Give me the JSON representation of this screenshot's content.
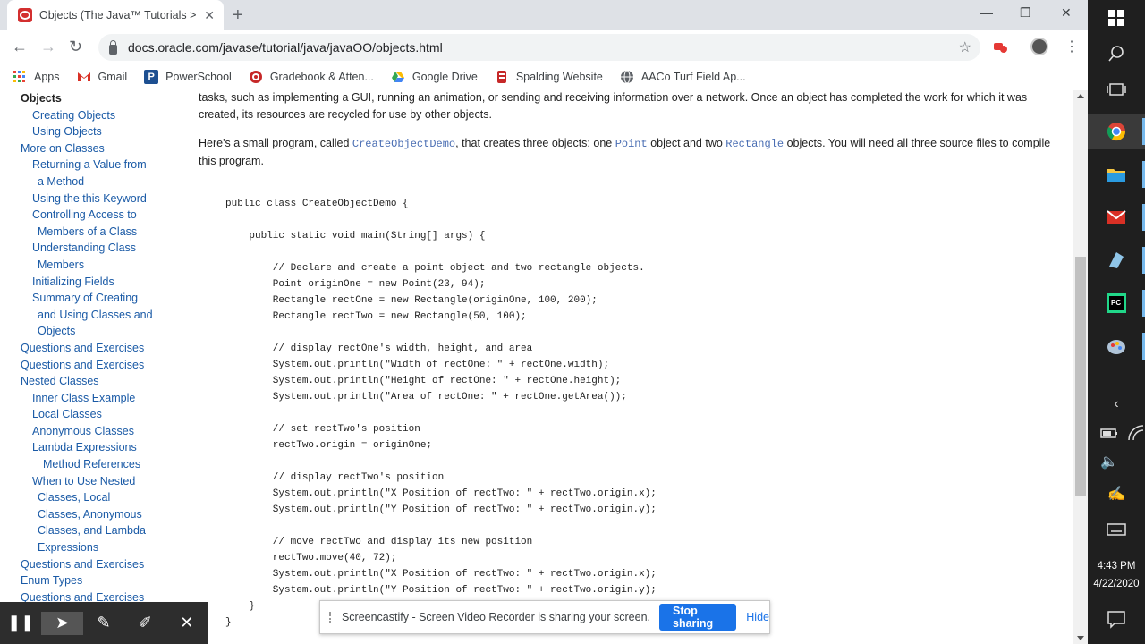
{
  "browser": {
    "tab_title": "Objects (The Java™ Tutorials > Le",
    "url": "docs.oracle.com/javase/tutorial/java/javaOO/objects.html"
  },
  "bookmarks": [
    {
      "label": "Apps",
      "icon": "apps-grid-icon",
      "color": "#4285f4"
    },
    {
      "label": "Gmail",
      "icon": "gmail-icon",
      "color": "#d93025"
    },
    {
      "label": "PowerSchool",
      "icon": "powerschool-icon",
      "color": "#1d4f91"
    },
    {
      "label": "Gradebook & Atten...",
      "icon": "gradebook-icon",
      "color": "#c62828"
    },
    {
      "label": "Google Drive",
      "icon": "google-drive-icon",
      "color": "#fbbc04"
    },
    {
      "label": "Spalding Website",
      "icon": "spalding-icon",
      "color": "#c62828"
    },
    {
      "label": "AACo Turf Field Ap...",
      "icon": "globe-icon",
      "color": "#5f6368"
    }
  ],
  "sidebar": [
    {
      "label": "Objects",
      "level": 1,
      "current": true
    },
    {
      "label": "Creating Objects",
      "level": 2
    },
    {
      "label": "Using Objects",
      "level": 2
    },
    {
      "label": "More on Classes",
      "level": 1
    },
    {
      "label": "Returning a Value from",
      "level": 2
    },
    {
      "label": "a Method",
      "level": 2,
      "cont": true
    },
    {
      "label": "Using the this Keyword",
      "level": 2
    },
    {
      "label": "Controlling Access to",
      "level": 2
    },
    {
      "label": "Members of a Class",
      "level": 2,
      "cont": true
    },
    {
      "label": "Understanding Class",
      "level": 2
    },
    {
      "label": "Members",
      "level": 2,
      "cont": true
    },
    {
      "label": "Initializing Fields",
      "level": 2
    },
    {
      "label": "Summary of Creating",
      "level": 2
    },
    {
      "label": "and Using Classes and",
      "level": 2,
      "cont": true
    },
    {
      "label": "Objects",
      "level": 2,
      "cont": true
    },
    {
      "label": "Questions and Exercises",
      "level": 1
    },
    {
      "label": "Questions and Exercises",
      "level": 1
    },
    {
      "label": "Nested Classes",
      "level": 1
    },
    {
      "label": "Inner Class Example",
      "level": 2
    },
    {
      "label": "Local Classes",
      "level": 2
    },
    {
      "label": "Anonymous Classes",
      "level": 2
    },
    {
      "label": "Lambda Expressions",
      "level": 2
    },
    {
      "label": "Method References",
      "level": 3
    },
    {
      "label": "When to Use Nested",
      "level": 2
    },
    {
      "label": "Classes, Local",
      "level": 2,
      "cont": true
    },
    {
      "label": "Classes, Anonymous",
      "level": 2,
      "cont": true
    },
    {
      "label": "Classes, and Lambda",
      "level": 2,
      "cont": true
    },
    {
      "label": "Expressions",
      "level": 2,
      "cont": true
    },
    {
      "label": "Questions and Exercises",
      "level": 1
    },
    {
      "label": "Enum Types",
      "level": 1
    },
    {
      "label": "Questions and Exercises",
      "level": 1
    }
  ],
  "article": {
    "p1": "tasks, such as implementing a GUI, running an animation, or sending and receiving information over a network. Once an object has completed the work for which it was created, its resources are recycled for use by other objects.",
    "p2_a": "Here's a small program, called ",
    "p2_code1": "CreateObjectDemo",
    "p2_b": ", that creates three objects: one ",
    "p2_code2": "Point",
    "p2_c": " object and two ",
    "p2_code3": "Rectangle",
    "p2_d": " objects. You will need all three source files to compile this program.",
    "code": [
      "public class CreateObjectDemo {",
      "",
      "    public static void main(String[] args) {",
      "",
      "        // Declare and create a point object and two rectangle objects.",
      "        Point originOne = new Point(23, 94);",
      "        Rectangle rectOne = new Rectangle(originOne, 100, 200);",
      "        Rectangle rectTwo = new Rectangle(50, 100);",
      "",
      "        // display rectOne's width, height, and area",
      "        System.out.println(\"Width of rectOne: \" + rectOne.width);",
      "        System.out.println(\"Height of rectOne: \" + rectOne.height);",
      "        System.out.println(\"Area of rectOne: \" + rectOne.getArea());",
      "",
      "        // set rectTwo's position",
      "        rectTwo.origin = originOne;",
      "",
      "        // display rectTwo's position",
      "        System.out.println(\"X Position of rectTwo: \" + rectTwo.origin.x);",
      "        System.out.println(\"Y Position of rectTwo: \" + rectTwo.origin.y);",
      "",
      "        // move rectTwo and display its new position",
      "        rectTwo.move(40, 72);",
      "        System.out.println(\"X Position of rectTwo: \" + rectTwo.origin.x);",
      "        System.out.println(\"Y Position of rectTwo: \" + rectTwo.origin.y);",
      "    }",
      "}"
    ]
  },
  "screencastify": {
    "message": "Screencastify - Screen Video Recorder is sharing your screen.",
    "stop_label": "Stop sharing",
    "hide_label": "Hide"
  },
  "taskbar": {
    "time": "4:43 PM",
    "date": "4/22/2020"
  },
  "colors": {
    "link": "#1a5aa6",
    "inline_code": "#4a6eb3",
    "stop_button": "#1a73e8"
  }
}
